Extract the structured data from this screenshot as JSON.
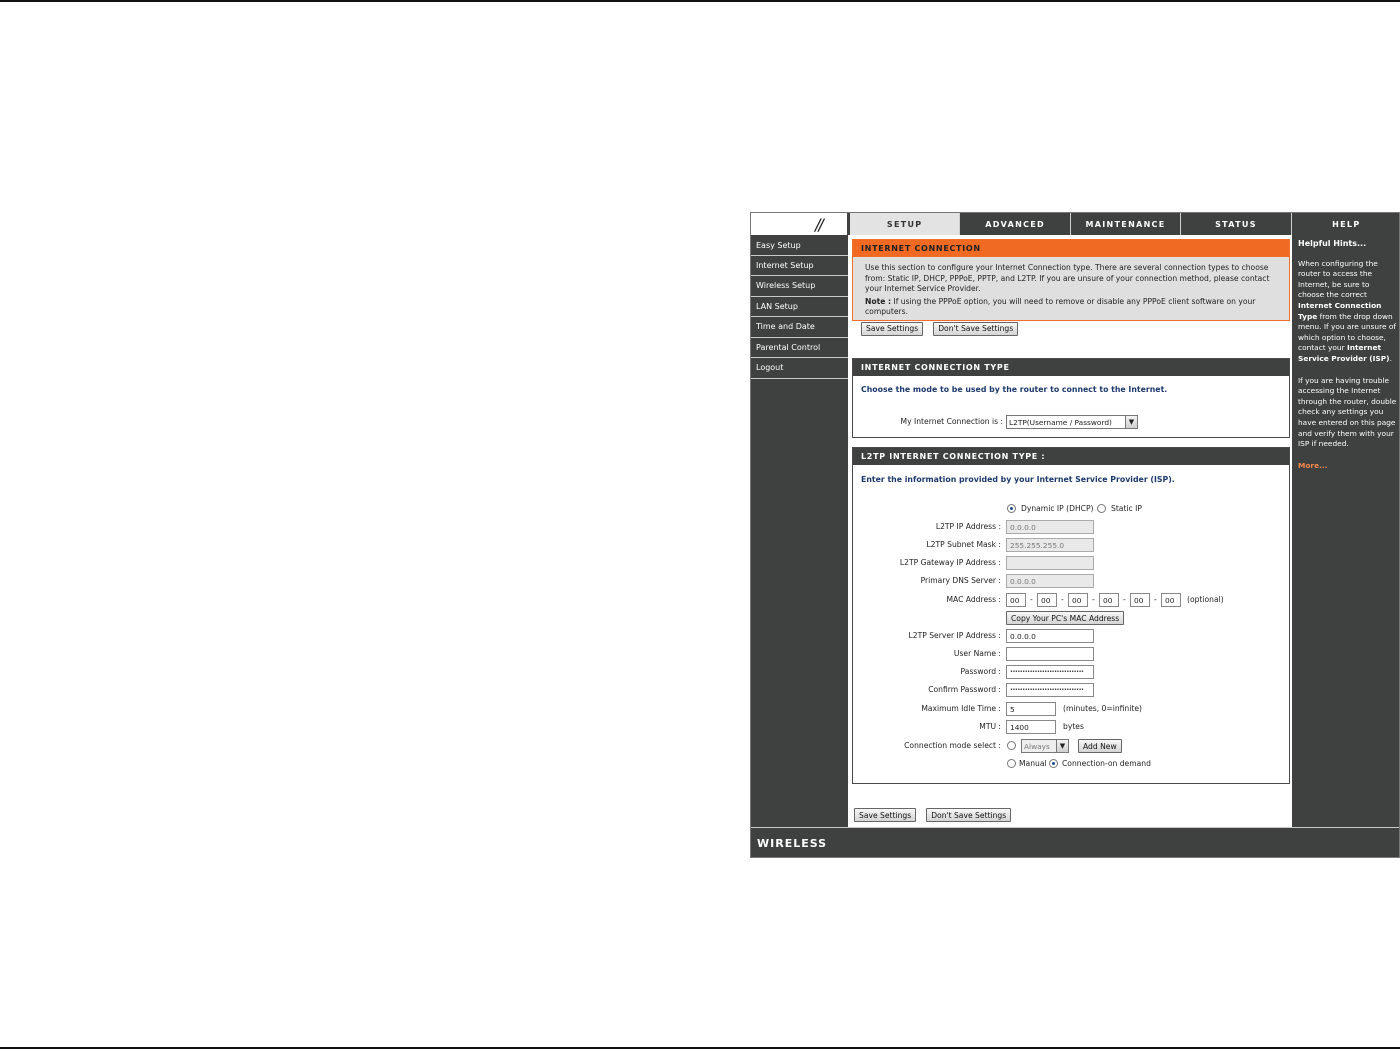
{
  "tabs": [
    "SETUP",
    "ADVANCED",
    "MAINTENANCE",
    "STATUS",
    "HELP"
  ],
  "sidebar": {
    "items": [
      "Easy Setup",
      "Internet Setup",
      "Wireless Setup",
      "LAN Setup",
      "Time and Date",
      "Parental Control",
      "Logout"
    ]
  },
  "internet_connection": {
    "title": "INTERNET CONNECTION",
    "description": "Use this section to configure your Internet Connection type. There are several connection types to choose from: Static IP, DHCP, PPPoE, PPTP, and L2TP. If you are unsure of your connection method, please contact your Internet Service Provider.",
    "note_label": "Note :",
    "note_text": " If using the PPPoE option, you will need to remove or disable any PPPoE client software on your computers.",
    "save_label": "Save Settings",
    "dont_save_label": "Don't Save Settings"
  },
  "connection_type": {
    "title": "INTERNET CONNECTION TYPE",
    "lead": "Choose the mode to be used by the router to connect to the Internet.",
    "label": "My Internet Connection is :",
    "selected": "L2TP(Username / Password)"
  },
  "l2tp": {
    "title": "L2TP INTERNET CONNECTION TYPE :",
    "lead": "Enter the information provided by your Internet Service Provider (ISP).",
    "dynamic_label": "Dynamic IP (DHCP)",
    "static_label": "Static IP",
    "ip_label": "L2TP IP Address :",
    "ip_value": "0.0.0.0",
    "subnet_label": "L2TP Subnet Mask :",
    "subnet_value": "255.255.255.0",
    "gateway_label": "L2TP Gateway IP Address :",
    "gateway_value": "",
    "dns_label": "Primary DNS Server :",
    "dns_value": "0.0.0.0",
    "mac_label": "MAC Address :",
    "mac": [
      "00",
      "00",
      "00",
      "00",
      "00",
      "00"
    ],
    "mac_optional": "(optional)",
    "copy_mac_label": "Copy Your PC's MAC Address",
    "server_label": "L2TP Server IP Address :",
    "server_value": "0.0.0.0",
    "username_label": "User Name :",
    "username_value": "",
    "password_label": "Password :",
    "password_value": "••••••••••••••••••••••••••••••",
    "confirm_label": "Confirm Password :",
    "confirm_value": "••••••••••••••••••••••••••••••",
    "idle_label": "Maximum Idle Time :",
    "idle_value": "5",
    "idle_units": "(minutes, 0=infinite)",
    "mtu_label": "MTU :",
    "mtu_value": "1400",
    "mtu_units": "bytes",
    "mode_label": "Connection mode select :",
    "mode_always": "Always",
    "add_new_label": "Add New",
    "manual_label": "Manual",
    "on_demand_label": "Connection-on demand"
  },
  "bottom": {
    "save_label": "Save Settings",
    "dont_save_label": "Don't Save Settings"
  },
  "hints": {
    "title": "Helpful Hints...",
    "p1_a": "When configuring the router to access the Internet, be sure to choose the correct ",
    "p1_b": "Internet Connection Type",
    "p1_c": " from the drop down menu. If you are unsure of which option to choose, contact your ",
    "p1_d": "Internet Service Provider (ISP)",
    "p1_e": ".",
    "p2": "If you are having trouble accessing the Internet through the router, double check any settings you have entered on this page and verify them with your ISP if needed.",
    "more": "More..."
  },
  "footer": {
    "brand": "WIRELESS"
  },
  "colors": {
    "panel": "#3f4141",
    "accent_orange": "#f06a23",
    "heading_blue": "#1e3a6e",
    "more_link": "#f4884a"
  }
}
